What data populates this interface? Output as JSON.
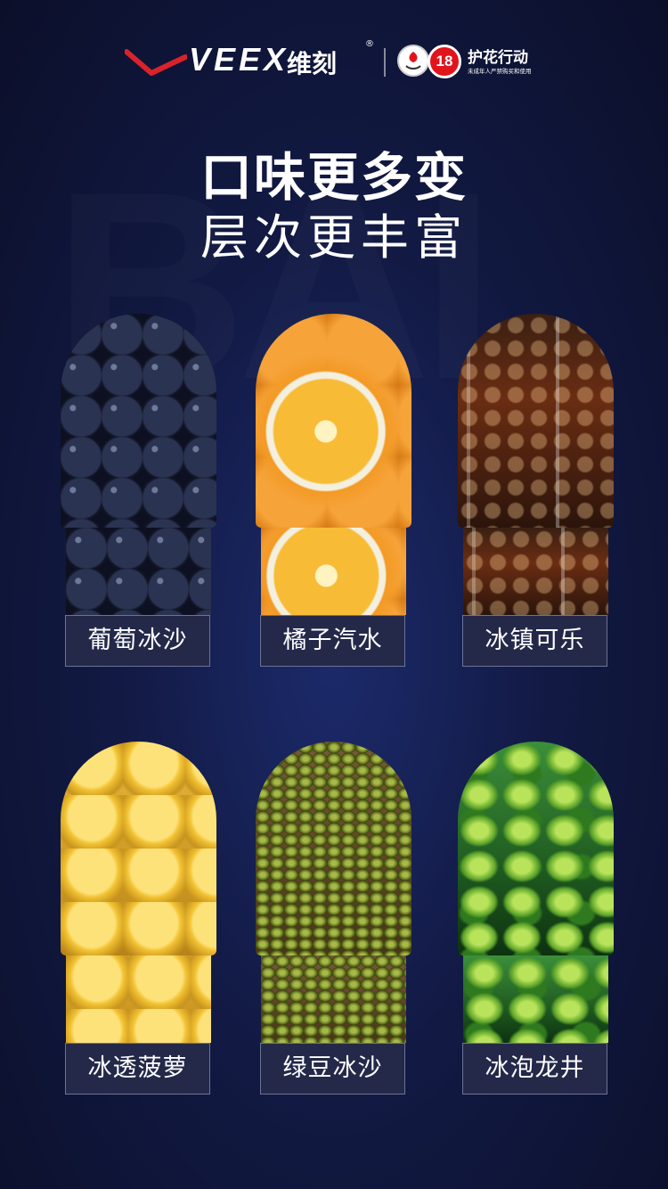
{
  "brand": {
    "name_en": "VEEX",
    "name_cn": "维刻",
    "registered_mark": "®",
    "accent_color": "#d9222a"
  },
  "campaign": {
    "badge_number": "18",
    "title": "护花行动",
    "subtitle": "未成年人严禁购买和使用"
  },
  "headline": {
    "line1": "口味更多变",
    "line2": "层次更丰富"
  },
  "watermark_text": "BAI",
  "flavors": [
    {
      "label": "葡萄冰沙",
      "image": "grape-photo"
    },
    {
      "label": "橘子汽水",
      "image": "orange-photo"
    },
    {
      "label": "冰镇可乐",
      "image": "cola-photo"
    },
    {
      "label": "冰透菠萝",
      "image": "pineapple-photo"
    },
    {
      "label": "绿豆冰沙",
      "image": "mung-bean-photo"
    },
    {
      "label": "冰泡龙井",
      "image": "tea-leaf-photo"
    }
  ]
}
